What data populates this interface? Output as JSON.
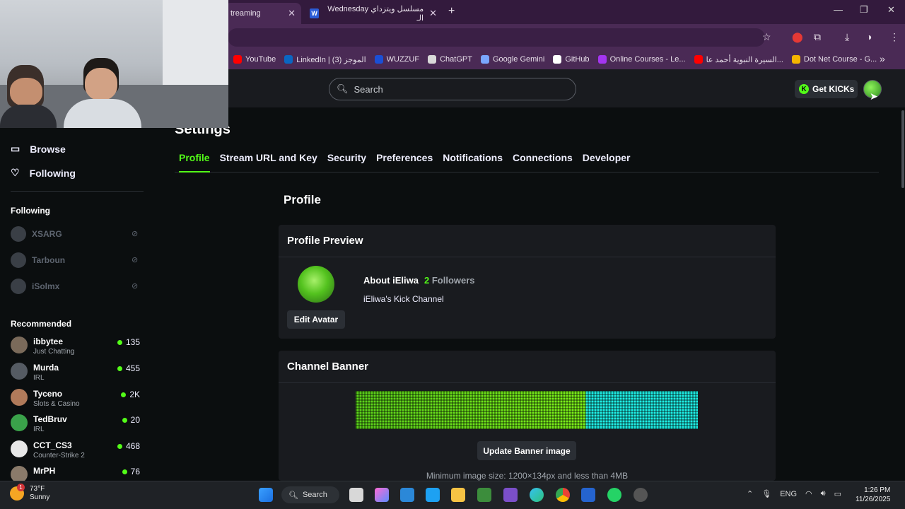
{
  "browser": {
    "tabs": [
      {
        "title": "treaming"
      },
      {
        "title": "مسلسل ويتزداي Wednesday الـ"
      }
    ],
    "new_tab": "+",
    "bookmarks": [
      {
        "label": "YouTube",
        "color": "#ff0000"
      },
      {
        "label": "LinkedIn | الموجز (3)",
        "color": "#0a66c2"
      },
      {
        "label": "WUZZUF",
        "color": "#1a4fd6"
      },
      {
        "label": "ChatGPT",
        "color": "#d9d9d9"
      },
      {
        "label": "Google Gemini",
        "color": "#7aa7ff"
      },
      {
        "label": "GitHub",
        "color": "#ffffff"
      },
      {
        "label": "Online Courses - Le...",
        "color": "#a435f0"
      },
      {
        "label": "السيرة النبوية أحمد عا...",
        "color": "#ff0000"
      },
      {
        "label": "Dot Net Course - G...",
        "color": "#f4b400"
      }
    ],
    "more": "»"
  },
  "header": {
    "search_placeholder": "Search",
    "get_kicks": "Get KICKs"
  },
  "sidebar": {
    "nav": [
      {
        "label": "Browse"
      },
      {
        "label": "Following"
      }
    ],
    "following_title": "Following",
    "following": [
      {
        "name": "XSARG"
      },
      {
        "name": "Tarboun"
      },
      {
        "name": "iSolmx"
      }
    ],
    "recommended_title": "Recommended",
    "recommended": [
      {
        "name": "ibbytee",
        "category": "Just Chatting",
        "viewers": "135",
        "color": "#7a6a5a"
      },
      {
        "name": "Murda",
        "category": "IRL",
        "viewers": "455",
        "color": "#555b63"
      },
      {
        "name": "Tyceno",
        "category": "Slots & Casino",
        "viewers": "2K",
        "color": "#b07a5a"
      },
      {
        "name": "TedBruv",
        "category": "IRL",
        "viewers": "20",
        "color": "#3aa24a"
      },
      {
        "name": "CCT_CS3",
        "category": "Counter-Strike 2",
        "viewers": "468",
        "color": "#e8e8e8"
      },
      {
        "name": "MrPH",
        "category": "",
        "viewers": "76",
        "color": "#8a7a6a"
      }
    ]
  },
  "main": {
    "title": "Settings",
    "tabs": [
      {
        "label": "Profile",
        "active": true
      },
      {
        "label": "Stream URL and Key"
      },
      {
        "label": "Security"
      },
      {
        "label": "Preferences"
      },
      {
        "label": "Notifications"
      },
      {
        "label": "Connections"
      },
      {
        "label": "Developer"
      }
    ],
    "section_title": "Profile",
    "preview": {
      "title": "Profile Preview",
      "about": "About iEliwa",
      "followers_count": "2",
      "followers_label": "Followers",
      "description": "iEliwa's Kick Channel",
      "edit_avatar": "Edit Avatar"
    },
    "banner": {
      "title": "Channel Banner",
      "update_button": "Update Banner image",
      "hint": "Minimum image size: 1200×134px and less than 4MB"
    }
  },
  "taskbar": {
    "weather_temp": "73°F",
    "weather_desc": "Sunny",
    "weather_badge": "1",
    "search": "Search",
    "lang": "ENG",
    "time": "1:26 PM",
    "date": "11/26/2025"
  }
}
